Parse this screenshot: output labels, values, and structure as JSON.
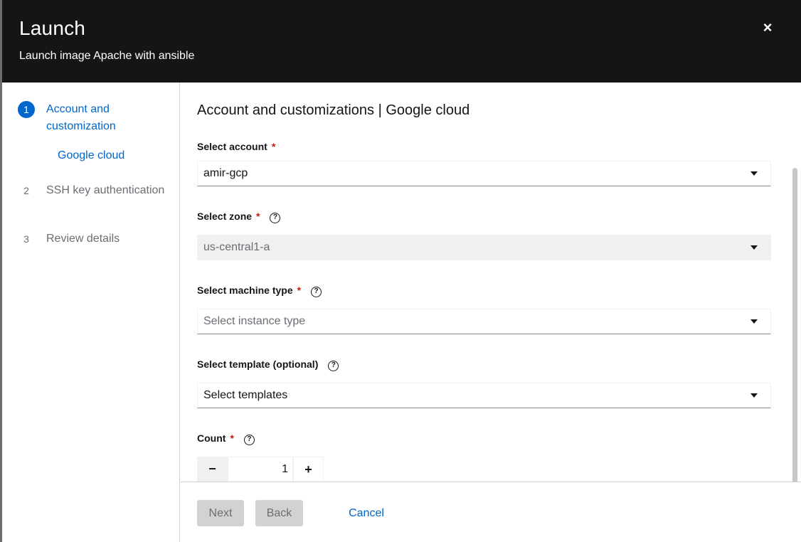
{
  "modal": {
    "title": "Launch",
    "subtitle": "Launch image Apache with ansible",
    "close_label": "×"
  },
  "nav": {
    "steps": [
      {
        "number": "1",
        "label": "Account and customization",
        "current": true
      },
      {
        "number": "2",
        "label": "SSH key authentication",
        "current": false
      },
      {
        "number": "3",
        "label": "Review details",
        "current": false
      }
    ],
    "substep": "Google cloud"
  },
  "form": {
    "section_title": "Account and customizations | Google cloud",
    "account": {
      "label": "Select account",
      "required": "*",
      "value": "amir-gcp"
    },
    "zone": {
      "label": "Select zone",
      "required": "*",
      "help": "?",
      "value": "us-central1-a",
      "disabled": true
    },
    "machine_type": {
      "label": "Select machine type",
      "required": "*",
      "help": "?",
      "placeholder": "Select instance type"
    },
    "template": {
      "label": "Select template (optional)",
      "help": "?",
      "value": "Select templates"
    },
    "count": {
      "label": "Count",
      "required": "*",
      "help": "?",
      "value": "1",
      "minus": "−",
      "plus": "+"
    }
  },
  "footer": {
    "next_label": "Next",
    "back_label": "Back",
    "cancel_label": "Cancel"
  },
  "colors": {
    "accent": "#0066cc",
    "header_bg": "#151515",
    "required": "#c9190b"
  }
}
